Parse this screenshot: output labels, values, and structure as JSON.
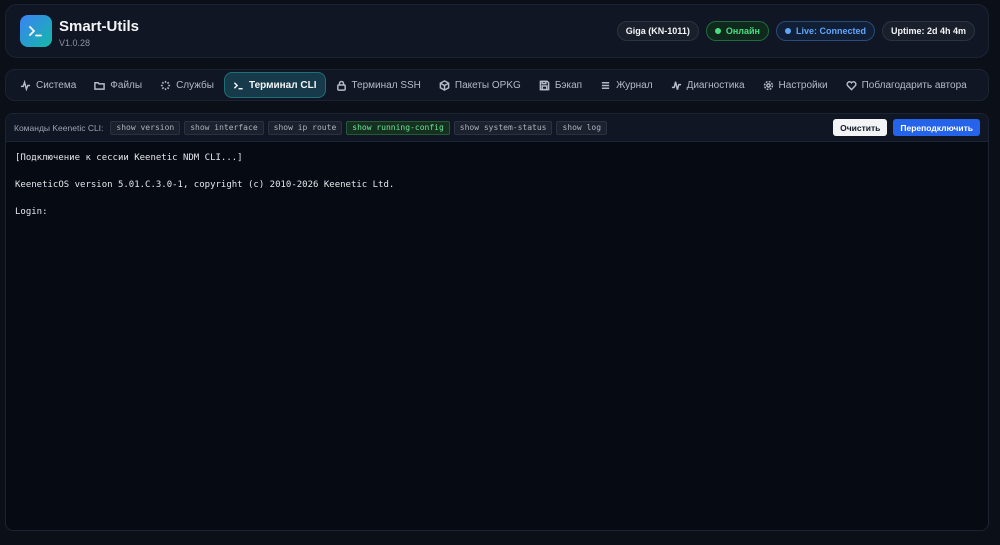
{
  "app": {
    "title": "Smart-Utils",
    "version": "V1.0.28"
  },
  "status": {
    "device": "Giga (KN-1011)",
    "online": "Онлайн",
    "live": "Live: Connected",
    "uptime": "Uptime: 2d 4h 4m"
  },
  "nav": {
    "tabs": [
      {
        "label": "Система",
        "icon": "activity-icon"
      },
      {
        "label": "Файлы",
        "icon": "folder-icon"
      },
      {
        "label": "Службы",
        "icon": "loader-icon"
      },
      {
        "label": "Терминал CLI",
        "icon": "terminal-icon",
        "active": true
      },
      {
        "label": "Терминал SSH",
        "icon": "lock-icon"
      },
      {
        "label": "Пакеты OPKG",
        "icon": "package-icon"
      },
      {
        "label": "Бэкап",
        "icon": "save-icon"
      },
      {
        "label": "Журнал",
        "icon": "list-icon"
      },
      {
        "label": "Диагностика",
        "icon": "pulse-icon"
      },
      {
        "label": "Настройки",
        "icon": "gear-icon"
      },
      {
        "label": "Поблагодарить автора",
        "icon": "heart-icon"
      }
    ]
  },
  "toolbar": {
    "label": "Команды Keenetic CLI:",
    "commands": [
      "show version",
      "show interface",
      "show ip route",
      "show running-config",
      "show system-status",
      "show log"
    ],
    "clear_label": "Очистить",
    "reconnect_label": "Переподключить"
  },
  "terminal": {
    "lines": [
      "[Подключение к сессии Keenetic NDM CLI...]",
      "",
      "KeeneticOS version 5.01.C.3.0-1, copyright (c) 2010-2026 Keenetic Ltd.",
      "",
      "Login:"
    ]
  },
  "colors": {
    "accent": "#2563eb",
    "online": "#4ade80",
    "live": "#60a5fa",
    "highlight_command": "#6fe39a"
  }
}
